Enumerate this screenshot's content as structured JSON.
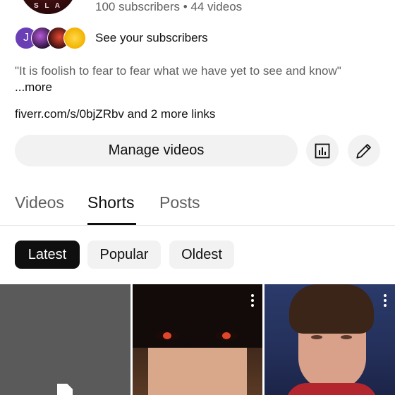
{
  "channel": {
    "avatar_wordmark": "S L A",
    "stats": "100 subscribers • 44 videos",
    "subscribers_link": "See your subscribers",
    "subscriber_avatar_initial": "J",
    "description": "\"It is foolish to fear to fear what we have yet to see and know\"",
    "description_more": "...more",
    "link_url": "fiverr.com/s/0bjZRbv",
    "link_more": "and 2 more links"
  },
  "actions": {
    "manage_videos": "Manage videos",
    "analytics_icon": "analytics-icon",
    "edit_icon": "edit-pencil-icon"
  },
  "tabs": [
    {
      "label": "Videos",
      "active": false
    },
    {
      "label": "Shorts",
      "active": true
    },
    {
      "label": "Posts",
      "active": false
    }
  ],
  "filters": [
    {
      "label": "Latest",
      "selected": true
    },
    {
      "label": "Popular",
      "selected": false
    },
    {
      "label": "Oldest",
      "selected": false
    }
  ],
  "shorts": [
    {
      "kind": "draft",
      "icon": "document-icon"
    },
    {
      "kind": "anime-character",
      "icon": "more-vert-icon"
    },
    {
      "kind": "person-portrait",
      "icon": "more-vert-icon"
    }
  ],
  "colors": {
    "text_primary": "#0f0f0f",
    "text_secondary": "#606060",
    "chip_bg": "#f2f2f2",
    "chip_selected_bg": "#0f0f0f"
  }
}
